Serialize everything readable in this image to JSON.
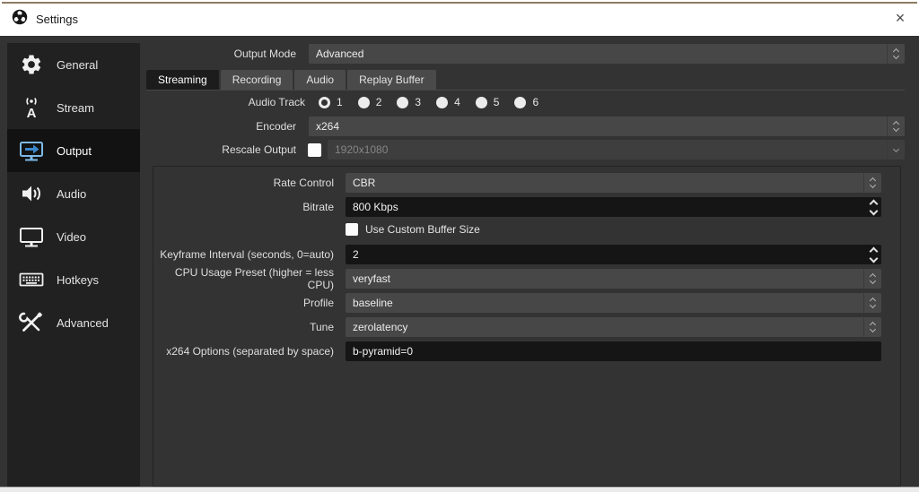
{
  "window": {
    "title": "Settings",
    "close_label": "×"
  },
  "colors": {
    "titlebar_bg": "#ffffff",
    "accent_line": "#8d7b61",
    "main_bg": "#333333",
    "sidebar_bg": "#212121",
    "selected_item_bg": "#121212",
    "selected_icon_blue": "#7cb9e8",
    "combo_bg": "#474747",
    "input_bg": "#151515",
    "active_tab_bg": "#1c1c1c"
  },
  "sidebar": {
    "items": [
      {
        "label": "General",
        "icon": "gear-icon",
        "selected": false
      },
      {
        "label": "Stream",
        "icon": "broadcast-icon",
        "selected": false
      },
      {
        "label": "Output",
        "icon": "monitor-arrow-icon",
        "selected": true
      },
      {
        "label": "Audio",
        "icon": "speaker-icon",
        "selected": false
      },
      {
        "label": "Video",
        "icon": "monitor-icon",
        "selected": false
      },
      {
        "label": "Hotkeys",
        "icon": "keyboard-icon",
        "selected": false
      },
      {
        "label": "Advanced",
        "icon": "tools-icon",
        "selected": false
      }
    ]
  },
  "page": {
    "output_mode": {
      "label": "Output Mode",
      "value": "Advanced"
    },
    "tabs": [
      {
        "label": "Streaming",
        "active": true
      },
      {
        "label": "Recording",
        "active": false
      },
      {
        "label": "Audio",
        "active": false
      },
      {
        "label": "Replay Buffer",
        "active": false
      }
    ],
    "audio_track": {
      "label": "Audio Track",
      "selected": "1",
      "options": [
        "1",
        "2",
        "3",
        "4",
        "5",
        "6"
      ]
    },
    "encoder": {
      "label": "Encoder",
      "value": "x264"
    },
    "rescale": {
      "label": "Rescale Output",
      "checked": false,
      "value": "1920x1080"
    },
    "group": {
      "rate_control": {
        "label": "Rate Control",
        "value": "CBR"
      },
      "bitrate": {
        "label": "Bitrate",
        "value": "800 Kbps"
      },
      "custom_buffer": {
        "label": "Use Custom Buffer Size",
        "checked": false
      },
      "keyframe": {
        "label": "Keyframe Interval (seconds, 0=auto)",
        "value": "2"
      },
      "cpu_preset": {
        "label": "CPU Usage Preset (higher = less CPU)",
        "value": "veryfast"
      },
      "profile": {
        "label": "Profile",
        "value": "baseline"
      },
      "tune": {
        "label": "Tune",
        "value": "zerolatency"
      },
      "x264": {
        "label": "x264 Options (separated by space)",
        "value": "b-pyramid=0"
      }
    }
  }
}
